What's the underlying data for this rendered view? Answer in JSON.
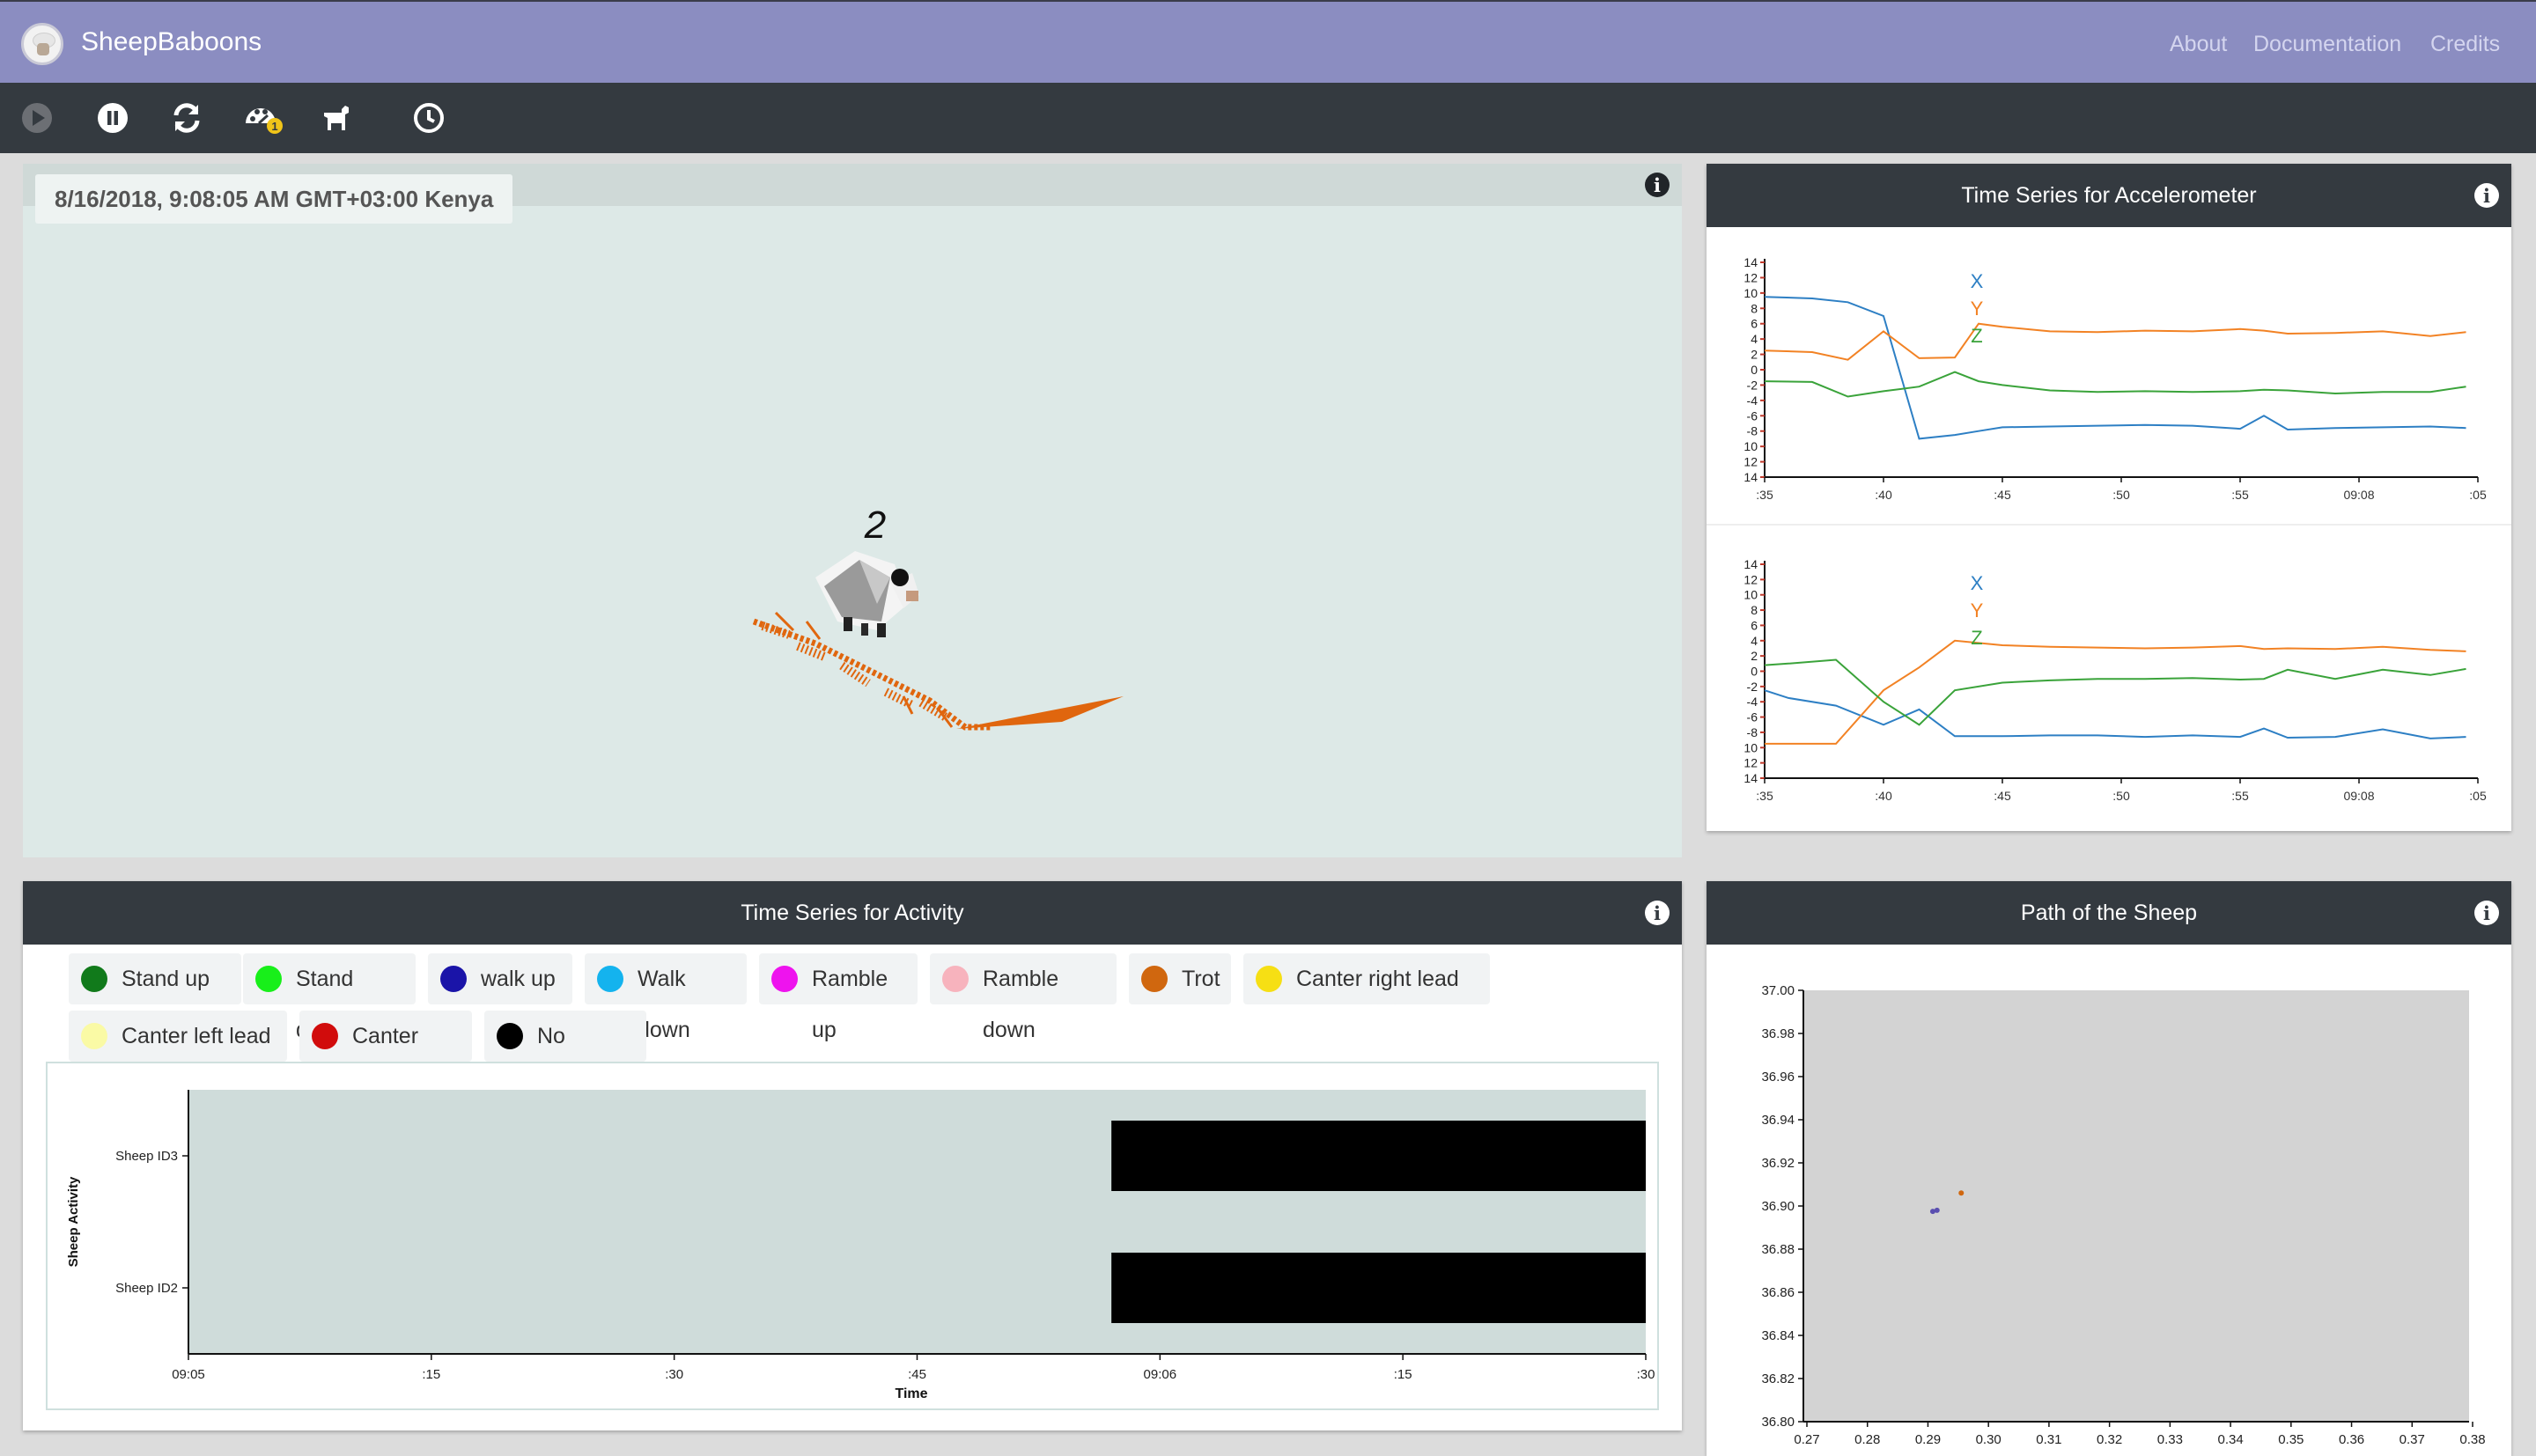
{
  "navbar": {
    "brand": "SheepBaboons",
    "links": [
      "About",
      "Documentation",
      "Credits"
    ]
  },
  "toolbar": {
    "icons": [
      "play-icon",
      "pause-icon",
      "refresh-icon",
      "palette-icon",
      "animal-icon",
      "clock-icon"
    ],
    "palette_badge": "1"
  },
  "scene": {
    "datetime": "8/16/2018, 9:08:05 AM GMT+03:00 Kenya",
    "sheep_label": "2"
  },
  "accelerometer": {
    "title": "Time Series for Accelerometer"
  },
  "activity": {
    "title": "Time Series for Activity",
    "legend": [
      {
        "label": "Stand up",
        "color": "#117a1b"
      },
      {
        "label": "Stand down",
        "color": "#18ef1a"
      },
      {
        "label": "walk up",
        "color": "#1a14a8"
      },
      {
        "label": "Walk down",
        "color": "#14b3ee"
      },
      {
        "label": "Ramble up",
        "color": "#ee13ee"
      },
      {
        "label": "Ramble down",
        "color": "#f7b3bd"
      },
      {
        "label": "Trot",
        "color": "#d0670f"
      },
      {
        "label": "Canter right lead",
        "color": "#f6df14"
      },
      {
        "label": "Canter left lead",
        "color": "#fafaa5"
      },
      {
        "label": "Canter unk",
        "color": "#d10c0c"
      },
      {
        "label": "No Activity",
        "color": "#000000"
      }
    ]
  },
  "path": {
    "title": "Path of the Sheep"
  },
  "chart_data": [
    {
      "type": "line",
      "title": "",
      "xlabel": "",
      "ylabel": "",
      "x_ticks": [
        ":35",
        ":40",
        ":45",
        ":50",
        ":55",
        "09:08",
        ":05"
      ],
      "y_ticks": [
        "14",
        "12",
        "10",
        "8",
        "6",
        "4",
        "2",
        "0",
        "-2",
        "-4",
        "-6",
        "-8",
        "10",
        "12",
        "14"
      ],
      "ylim": [
        -14,
        14
      ],
      "xlim": [
        35,
        65
      ],
      "x": [
        35,
        37,
        38.5,
        40,
        41.5,
        43,
        44,
        45,
        47,
        49,
        51,
        53,
        55,
        56,
        57,
        59,
        61,
        63,
        64.5
      ],
      "series": [
        {
          "name": "X",
          "color": "#2d7fc4",
          "values": [
            9.5,
            9.3,
            8.8,
            7,
            -9,
            -8.5,
            -8,
            -7.5,
            -7.4,
            -7.3,
            -7.2,
            -7.3,
            -7.7,
            -6,
            -7.8,
            -7.6,
            -7.5,
            -7.4,
            -7.6
          ]
        },
        {
          "name": "Y",
          "color": "#f28224",
          "values": [
            2.5,
            2.3,
            1.3,
            5,
            1.5,
            1.6,
            6,
            5.6,
            5.0,
            4.9,
            5.1,
            5.0,
            5.3,
            5.1,
            4.7,
            4.8,
            5.0,
            4.4,
            4.9
          ]
        },
        {
          "name": "Z",
          "color": "#3aa33a",
          "values": [
            -1.5,
            -1.6,
            -3.5,
            -2.8,
            -2.2,
            -0.3,
            -1.5,
            -2.0,
            -2.7,
            -2.9,
            -2.8,
            -2.9,
            -2.8,
            -2.6,
            -2.7,
            -3.1,
            -2.9,
            -2.9,
            -2.2
          ]
        }
      ]
    },
    {
      "type": "line",
      "title": "",
      "xlabel": "",
      "ylabel": "",
      "x_ticks": [
        ":35",
        ":40",
        ":45",
        ":50",
        ":55",
        "09:08",
        ":05"
      ],
      "y_ticks": [
        "14",
        "12",
        "10",
        "8",
        "6",
        "4",
        "2",
        "0",
        "-2",
        "-4",
        "-6",
        "-8",
        "10",
        "12",
        "14"
      ],
      "ylim": [
        -14,
        14
      ],
      "xlim": [
        35,
        65
      ],
      "x": [
        35,
        36,
        38,
        40,
        41.5,
        43,
        45,
        47,
        49,
        51,
        53,
        55,
        56,
        57,
        59,
        61,
        63,
        64.5
      ],
      "series": [
        {
          "name": "X",
          "color": "#2d7fc4",
          "values": [
            -2.5,
            -3.5,
            -4.5,
            -7,
            -5,
            -8.5,
            -8.5,
            -8.4,
            -8.4,
            -8.6,
            -8.4,
            -8.6,
            -7.5,
            -8.7,
            -8.6,
            -7.6,
            -8.8,
            -8.6
          ]
        },
        {
          "name": "Y",
          "color": "#f28224",
          "values": [
            -9.5,
            -9.5,
            -9.5,
            -2.5,
            0.5,
            4,
            3.4,
            3.2,
            3.1,
            3.0,
            3.1,
            3.3,
            2.9,
            3.0,
            2.9,
            3.2,
            2.8,
            2.6
          ]
        },
        {
          "name": "Z",
          "color": "#3aa33a",
          "values": [
            0.8,
            1.0,
            1.5,
            -4,
            -7,
            -2.5,
            -1.5,
            -1.2,
            -1.0,
            -1.0,
            -0.9,
            -1.1,
            -1.0,
            0.2,
            -1.0,
            0.2,
            -0.5,
            0.3
          ]
        }
      ]
    },
    {
      "type": "bar",
      "title": "",
      "xlabel": "Time",
      "ylabel": "Sheep Activity",
      "categories": [
        "Sheep ID3",
        "Sheep ID2"
      ],
      "x_ticks": [
        "09:05",
        ":15",
        ":30",
        ":45",
        "09:06",
        ":15",
        ":30"
      ],
      "series": [
        {
          "name": "No Activity",
          "color": "#000000",
          "start": [
            "09:05:57",
            "09:05:57"
          ],
          "end": [
            "09:06:30",
            "09:06:30"
          ]
        }
      ]
    },
    {
      "type": "scatter",
      "title": "",
      "xlabel": "",
      "ylabel": "",
      "xlim": [
        0.27,
        0.38
      ],
      "ylim": [
        36.8,
        37.0
      ],
      "x_ticks": [
        "0.27",
        "0.28",
        "0.29",
        "0.30",
        "0.31",
        "0.32",
        "0.33",
        "0.34",
        "0.35",
        "0.36",
        "0.37",
        "0.38"
      ],
      "y_ticks": [
        "36.80",
        "36.82",
        "36.84",
        "36.86",
        "36.88",
        "36.90",
        "36.92",
        "36.94",
        "36.96",
        "36.98",
        "37.00"
      ],
      "points": [
        {
          "x": 0.2908,
          "y": 36.8975,
          "color": "#5a4fb0"
        },
        {
          "x": 0.2915,
          "y": 36.898,
          "color": "#5a4fb0"
        },
        {
          "x": 0.2955,
          "y": 36.906,
          "color": "#d0670f"
        }
      ]
    }
  ]
}
